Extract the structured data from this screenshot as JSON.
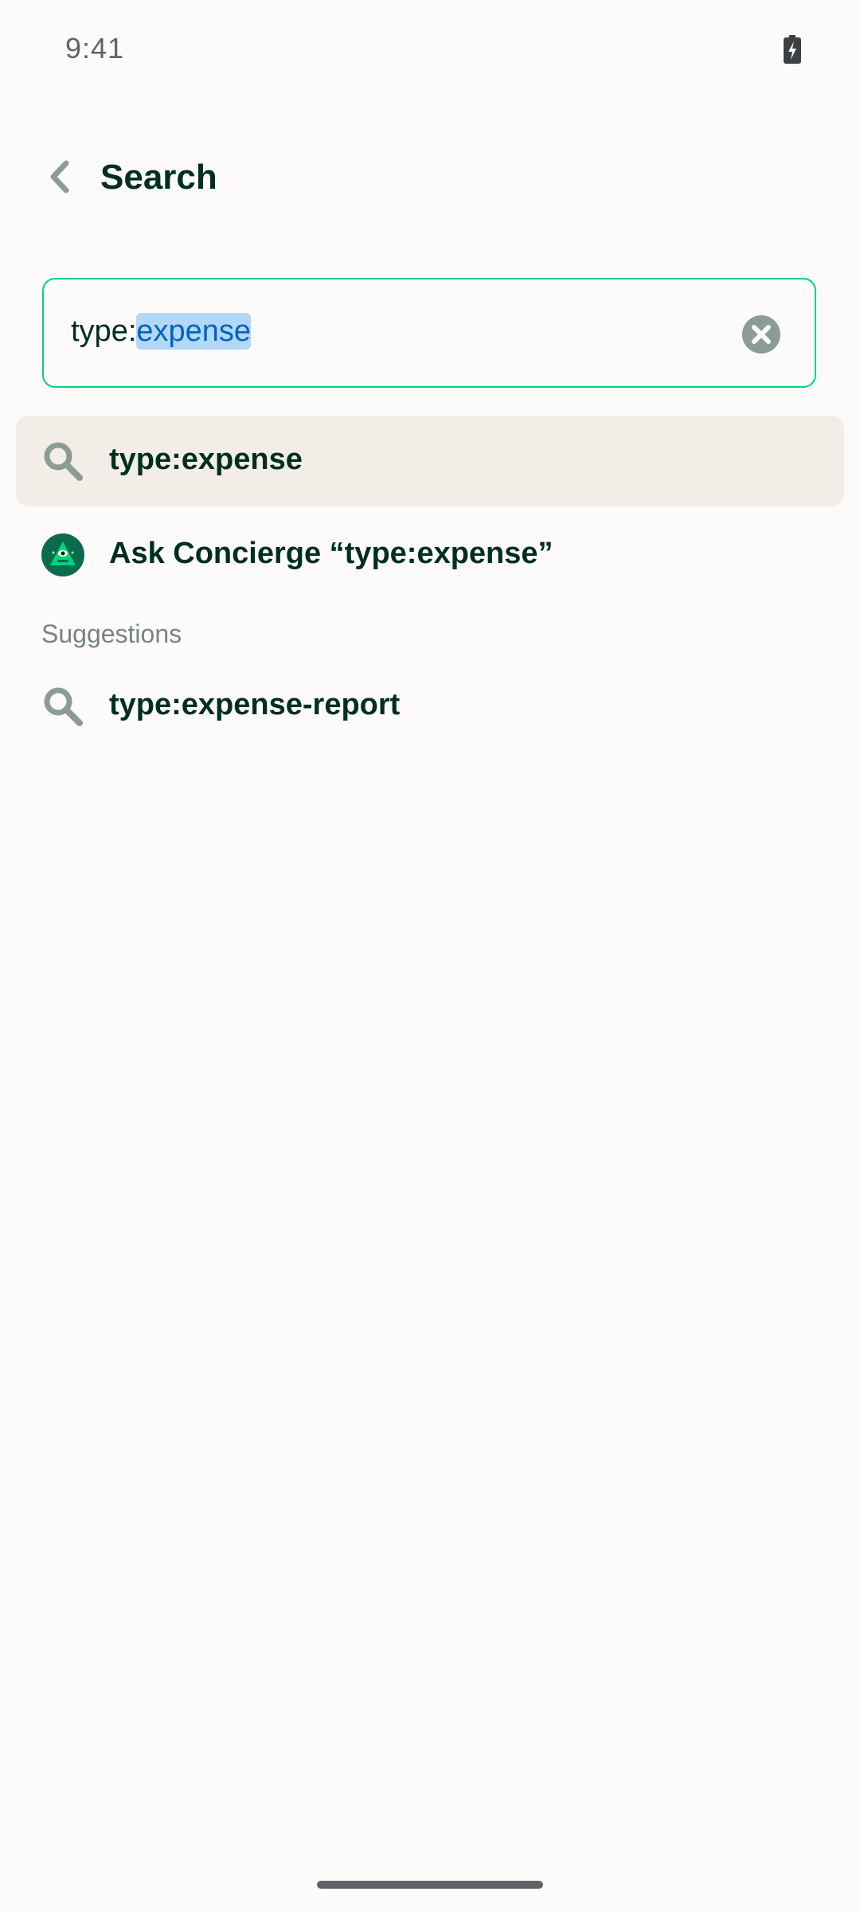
{
  "status_bar": {
    "time": "9:41",
    "battery_icon": "battery-charging-icon"
  },
  "header": {
    "back_icon": "chevron-left-icon",
    "title": "Search"
  },
  "search": {
    "value_prefix": "type:",
    "value_selected": "expense",
    "clear_icon": "clear-circle-icon",
    "border_color": "#03D47C"
  },
  "results": [
    {
      "icon": "search-icon",
      "label": "type:expense",
      "highlighted": true
    },
    {
      "icon": "concierge-avatar-icon",
      "label": "Ask Concierge “type:expense”",
      "highlighted": false
    }
  ],
  "suggestions": {
    "heading": "Suggestions",
    "items": [
      {
        "icon": "search-icon",
        "label": "type:expense-report"
      }
    ]
  },
  "colors": {
    "background": "#FCFBF9",
    "text": "#002E22",
    "accent": "#03D47C",
    "highlight_row": "#F2EDE7",
    "selection": "#B3D7F8"
  }
}
